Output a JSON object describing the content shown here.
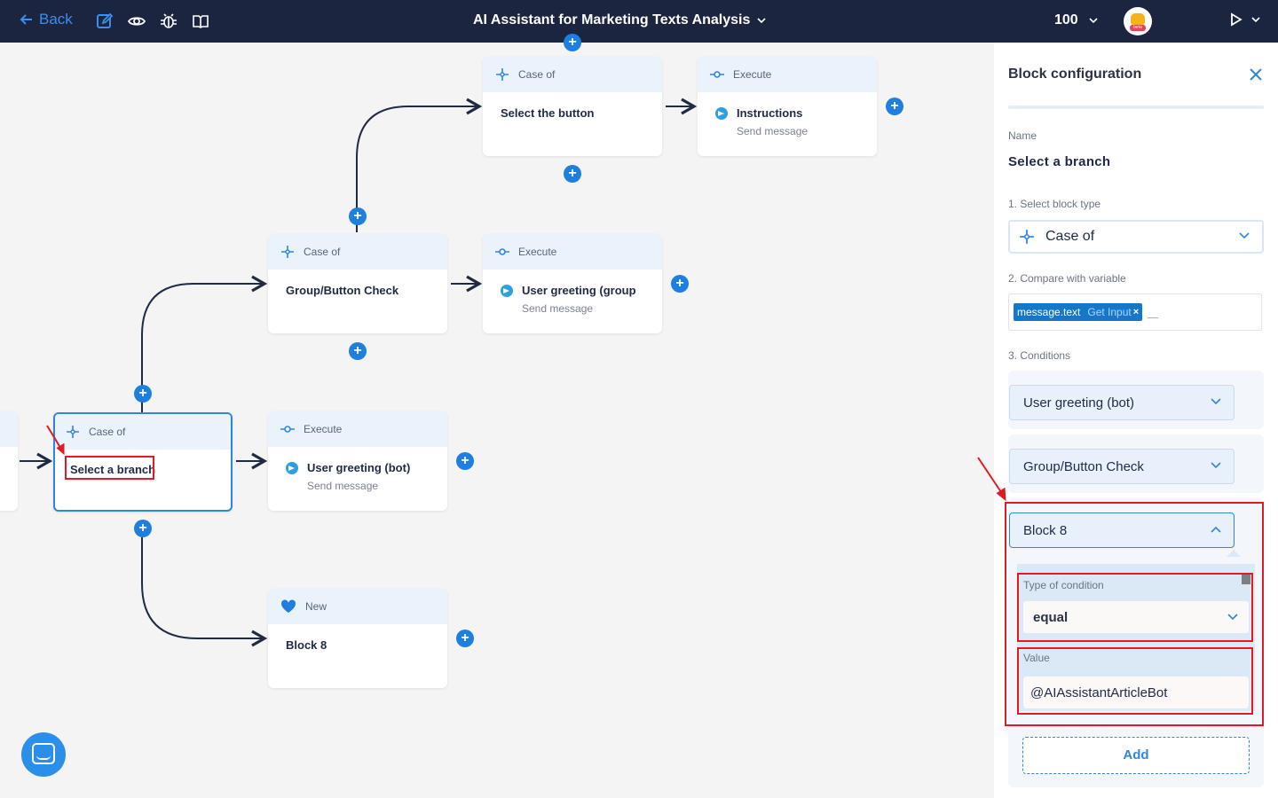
{
  "header": {
    "back_label": "Back",
    "title": "AI Assistant for Marketing Texts Analysis",
    "zoom": "100",
    "avatar_badge": "beta"
  },
  "canvas": {
    "nodes": [
      {
        "type_label": "Case of",
        "title": "Select the button",
        "subtitle": ""
      },
      {
        "type_label": "Execute",
        "title": "Instructions",
        "subtitle": "Send message"
      },
      {
        "type_label": "Case of",
        "title": "Group/Button Check",
        "subtitle": ""
      },
      {
        "type_label": "Execute",
        "title": "User greeting (group",
        "subtitle": "Send message"
      },
      {
        "type_label": "Case of",
        "title": "Select a branch",
        "subtitle": ""
      },
      {
        "type_label": "Execute",
        "title": "User greeting (bot)",
        "subtitle": "Send message"
      },
      {
        "type_label": "New",
        "title": "Block 8",
        "subtitle": ""
      }
    ],
    "plus_symbol": "+"
  },
  "panel": {
    "title": "Block configuration",
    "name_label": "Name",
    "name_value": "Select a branch",
    "block_type_label": "1. Select block type",
    "block_type_value": "Case of",
    "compare_label": "2. Compare with variable",
    "variable_chip": {
      "name": "message.text",
      "source": "Get Input",
      "remove": "×"
    },
    "conditions_label": "3. Conditions",
    "conditions": [
      {
        "label": "User greeting (bot)"
      },
      {
        "label": "Group/Button Check"
      },
      {
        "label": "Block 8"
      }
    ],
    "type_of_condition_label": "Type of condition",
    "type_of_condition_value": "equal",
    "value_label": "Value",
    "value_input": "@AIAssistantArticleBot",
    "add_label": "Add"
  },
  "colors": {
    "topbar": "#1b2540",
    "accent": "#2e86de",
    "annotation": "#e01b24"
  }
}
